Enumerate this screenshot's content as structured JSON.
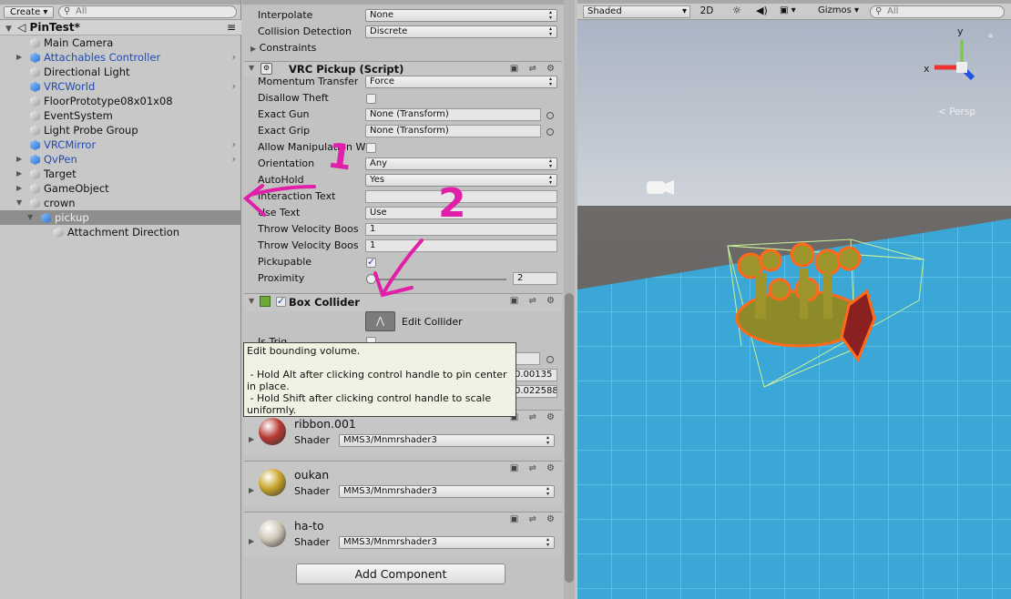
{
  "hierarchy": {
    "create_label": "Create",
    "search_placeholder": "All",
    "scene_name": "PinTest*",
    "items": [
      {
        "label": "Main Camera",
        "blue": false
      },
      {
        "label": "Attachables Controller",
        "blue": true
      },
      {
        "label": "Directional Light",
        "blue": false
      },
      {
        "label": "VRCWorld",
        "blue": true
      },
      {
        "label": "FloorPrototype08x01x08",
        "blue": false
      },
      {
        "label": "EventSystem",
        "blue": false
      },
      {
        "label": "Light Probe Group",
        "blue": false
      },
      {
        "label": "VRCMirror",
        "blue": true
      },
      {
        "label": "QvPen",
        "blue": true
      },
      {
        "label": "Target",
        "blue": false
      },
      {
        "label": "GameObject",
        "blue": false
      },
      {
        "label": "crown",
        "blue": false
      },
      {
        "label": "pickup",
        "blue": true,
        "selected": true
      },
      {
        "label": "Attachment Direction",
        "blue": false
      }
    ]
  },
  "inspector": {
    "rigidbody": {
      "interpolate_label": "Interpolate",
      "interpolate_value": "None",
      "collision_label": "Collision Detection",
      "collision_value": "Discrete",
      "constraints_label": "Constraints"
    },
    "pickup": {
      "title": "VRC Pickup (Script)",
      "momentum_label": "Momentum Transfer",
      "momentum_value": "Force",
      "theft_label": "Disallow Theft",
      "gun_label": "Exact Gun",
      "gun_value": "None (Transform)",
      "grip_label": "Exact Grip",
      "grip_value": "None (Transform)",
      "manip_label": "Allow Manipulation W",
      "orient_label": "Orientation",
      "orient_value": "Any",
      "autohold_label": "AutoHold",
      "autohold_value": "Yes",
      "interaction_label": "Interaction Text",
      "interaction_value": "",
      "usetext_label": "Use Text",
      "usetext_value": "Use",
      "tvb1_label": "Throw Velocity Boos",
      "tvb1_value": "1",
      "tvb2_label": "Throw Velocity Boos",
      "tvb2_value": "1",
      "pickupable_label": "Pickupable",
      "proximity_label": "Proximity",
      "proximity_value": "2"
    },
    "box_collider": {
      "title": "Box Collider",
      "edit_label": "Edit Collider",
      "trigger_label": "Is Trig",
      "center_value": "0.00135",
      "size_value": "0.022588"
    },
    "tooltip": "Edit bounding volume.\n\n - Hold Alt after clicking control handle to pin center in place.\n - Hold Shift after clicking control handle to scale uniformly.",
    "materials": [
      {
        "name": "ribbon.001",
        "shader_label": "Shader",
        "shader": "MMS3/Mnmrshader3",
        "color": "#b83a32"
      },
      {
        "name": "oukan",
        "shader_label": "Shader",
        "shader": "MMS3/Mnmrshader3",
        "color": "#c9a52a"
      },
      {
        "name": "ha-to",
        "shader_label": "Shader",
        "shader": "MMS3/Mnmrshader3",
        "color": "#cfc7b8"
      }
    ],
    "add_component": "Add Component"
  },
  "scene": {
    "shading": "Shaded",
    "mode_2d": "2D",
    "gizmos": "Gizmos",
    "search_placeholder": "All",
    "persp": "Persp",
    "axis_x": "x",
    "axis_y": "y"
  },
  "annotations": {
    "mark1": "1",
    "mark2": "2"
  }
}
